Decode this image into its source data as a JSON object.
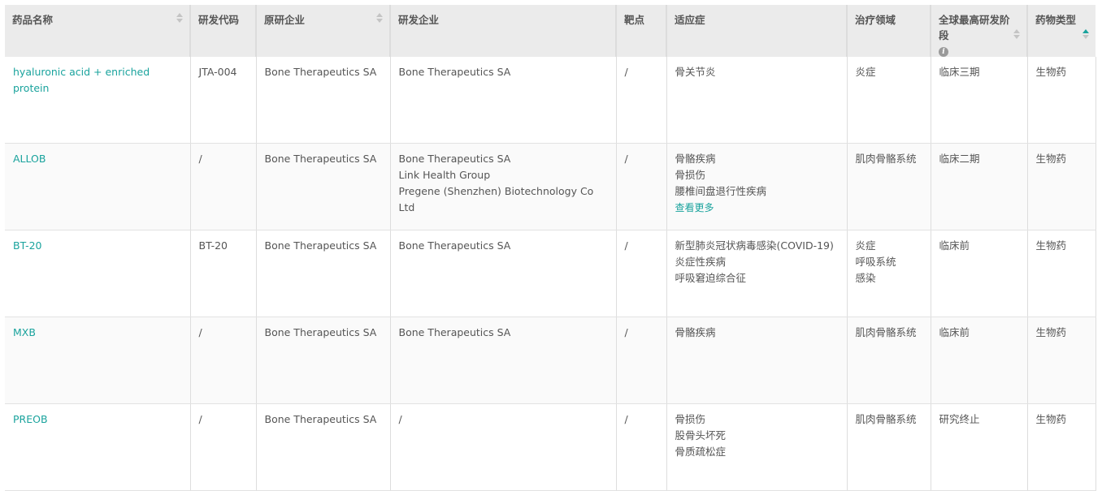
{
  "columns": [
    "药品名称",
    "研发代码",
    "原研企业",
    "研发企业",
    "靶点",
    "适应症",
    "治疗领域",
    "全球最高研发阶段",
    "药物类型"
  ],
  "info_icon": "i",
  "more_label": "查看更多",
  "rows": [
    {
      "name": "hyaluronic acid + enriched protein",
      "code": "JTA-004",
      "originator": "Bone Therapeutics SA",
      "developers": [
        "Bone Therapeutics SA"
      ],
      "target": "/",
      "indications": [
        "骨关节炎"
      ],
      "more": false,
      "areas": [
        "炎症"
      ],
      "phase": "临床三期",
      "type": "生物药"
    },
    {
      "name": "ALLOB",
      "code": "/",
      "originator": "Bone Therapeutics SA",
      "developers": [
        "Bone Therapeutics SA",
        "Link Health Group",
        "Pregene (Shenzhen) Biotechnology Co Ltd"
      ],
      "target": "/",
      "indications": [
        "骨骼疾病",
        "骨损伤",
        "腰椎间盘退行性疾病"
      ],
      "more": true,
      "areas": [
        "肌肉骨骼系统"
      ],
      "phase": "临床二期",
      "type": "生物药"
    },
    {
      "name": "BT-20",
      "code": "BT-20",
      "originator": "Bone Therapeutics SA",
      "developers": [
        "Bone Therapeutics SA"
      ],
      "target": "/",
      "indications": [
        "新型肺炎冠状病毒感染(COVID-19)",
        "炎症性疾病",
        "呼吸窘迫综合征"
      ],
      "more": false,
      "areas": [
        "炎症",
        "呼吸系统",
        "感染"
      ],
      "phase": "临床前",
      "type": "生物药"
    },
    {
      "name": "MXB",
      "code": "/",
      "originator": "Bone Therapeutics SA",
      "developers": [
        "Bone Therapeutics SA"
      ],
      "target": "/",
      "indications": [
        "骨骼疾病"
      ],
      "more": false,
      "areas": [
        "肌肉骨骼系统"
      ],
      "phase": "临床前",
      "type": "生物药"
    },
    {
      "name": "PREOB",
      "code": "/",
      "originator": "Bone Therapeutics SA",
      "developers": [
        "/"
      ],
      "target": "/",
      "indications": [
        "骨损伤",
        "股骨头坏死",
        "骨质疏松症"
      ],
      "more": false,
      "areas": [
        "肌肉骨骼系统"
      ],
      "phase": "研究终止",
      "type": "生物药"
    }
  ],
  "colors": {
    "accent": "#1aa39d",
    "header_bg": "#ebebeb"
  }
}
